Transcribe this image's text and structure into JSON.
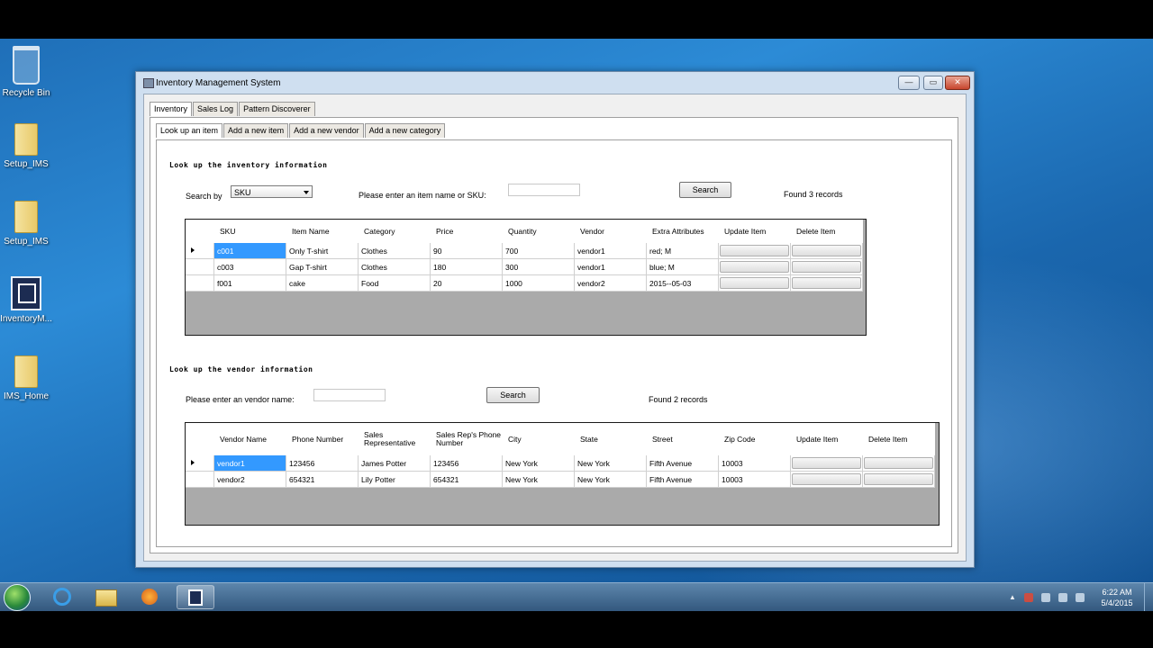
{
  "desktop": {
    "icons": [
      {
        "label": "Recycle Bin",
        "icon": "recycle-bin-icon"
      },
      {
        "label": "Setup_IMS",
        "icon": "folder-zip-icon"
      },
      {
        "label": "Setup_IMS",
        "icon": "folder-icon"
      },
      {
        "label": "InventoryM...",
        "icon": "app-shortcut-icon"
      },
      {
        "label": "IMS_Home",
        "icon": "folder-icon"
      }
    ]
  },
  "window": {
    "title": "Inventory Management System",
    "minimize": "—",
    "maximize": "▭",
    "close": "✕"
  },
  "main_tabs": [
    "Inventory",
    "Sales Log",
    "Pattern Discoverer"
  ],
  "sub_tabs": [
    "Look up an item",
    "Add a new item",
    "Add a new vendor",
    "Add a new category"
  ],
  "inventory": {
    "heading": "Look up the inventory information",
    "search_by_label": "Search by",
    "search_by_value": "SKU",
    "prompt": "Please enter an item name or SKU:",
    "search_value": "",
    "search_button": "Search",
    "result": "Found 3 records",
    "columns": [
      "SKU",
      "Item Name",
      "Category",
      "Price",
      "Quantity",
      "Vendor",
      "Extra Attributes",
      "Update Item",
      "Delete Item"
    ],
    "rows": [
      [
        "c001",
        "Only T-shirt",
        "Clothes",
        "90",
        "700",
        "vendor1",
        "red; M"
      ],
      [
        "c003",
        "Gap T-shirt",
        "Clothes",
        "180",
        "300",
        "vendor1",
        "blue; M"
      ],
      [
        "f001",
        "cake",
        "Food",
        "20",
        "1000",
        "vendor2",
        "2015--05-03"
      ]
    ]
  },
  "vendor": {
    "heading": "Look up the vendor information",
    "prompt": "Please enter an vendor name:",
    "search_value": "",
    "search_button": "Search",
    "result": "Found 2 records",
    "columns": [
      "Vendor Name",
      "Phone Number",
      "Sales Representative",
      "Sales Rep's Phone Number",
      "City",
      "State",
      "Street",
      "Zip Code",
      "Update Item",
      "Delete Item"
    ],
    "rows": [
      [
        "vendor1",
        "123456",
        "James Potter",
        "123456",
        "New York",
        "New York",
        "Fifth Avenue",
        "10003"
      ],
      [
        "vendor2",
        "654321",
        "Lily Potter",
        "654321",
        "New York",
        "New York",
        "Fifth Avenue",
        "10003"
      ]
    ]
  },
  "taskbar": {
    "time": "6:22 AM",
    "date": "5/4/2015"
  },
  "colors": {
    "selection": "#3399ff",
    "grid_empty": "#aaaaaa",
    "desktop": "#2c8bd6"
  }
}
